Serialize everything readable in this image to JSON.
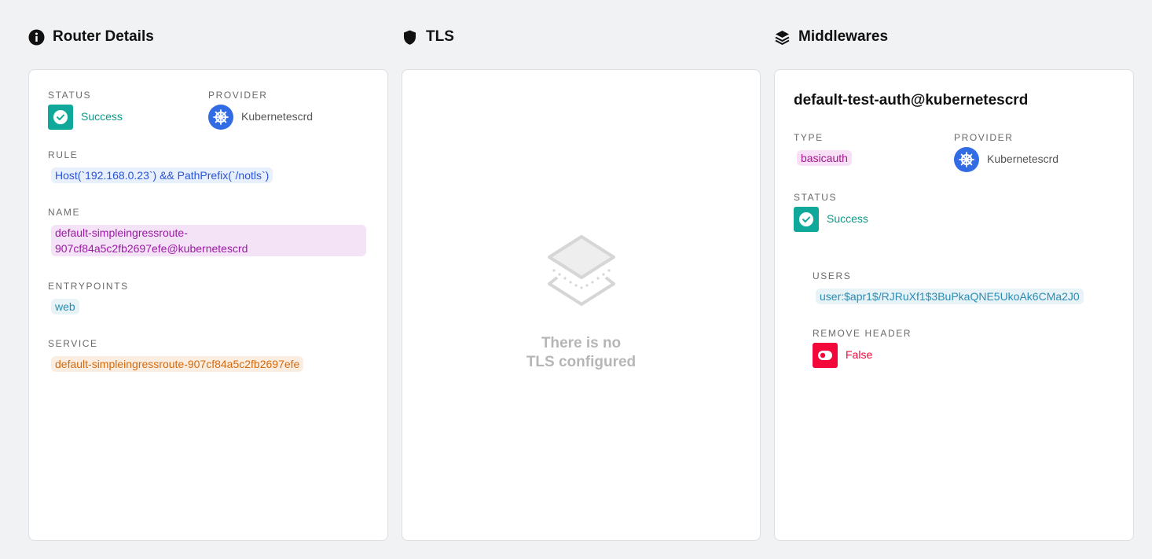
{
  "router": {
    "header": "Router Details",
    "status_label": "STATUS",
    "status_value": "Success",
    "provider_label": "PROVIDER",
    "provider_value": "Kubernetescrd",
    "rule_label": "RULE",
    "rule_value": "Host(`192.168.0.23`) && PathPrefix(`/notls`)",
    "name_label": "NAME",
    "name_value": "default-simpleingressroute-907cf84a5c2fb2697efe@kubernetescrd",
    "entrypoints_label": "ENTRYPOINTS",
    "entrypoint_value": "web",
    "service_label": "SERVICE",
    "service_value": "default-simpleingressroute-907cf84a5c2fb2697efe"
  },
  "tls": {
    "header": "TLS",
    "empty_line1": "There is no",
    "empty_line2": "TLS configured"
  },
  "middlewares": {
    "header": "Middlewares",
    "name": "default-test-auth@kubernetescrd",
    "type_label": "TYPE",
    "type_value": "basicauth",
    "provider_label": "PROVIDER",
    "provider_value": "Kubernetescrd",
    "status_label": "STATUS",
    "status_value": "Success",
    "users_label": "USERS",
    "users_value": "user:$apr1$/RJRuXf1$3BuPkaQNE5UkoAk6CMa2J0",
    "remove_header_label": "REMOVE HEADER",
    "remove_header_value": "False"
  },
  "colors": {
    "success": "#10a89b",
    "danger": "#f2083b",
    "kubernetes": "#326ce5"
  }
}
